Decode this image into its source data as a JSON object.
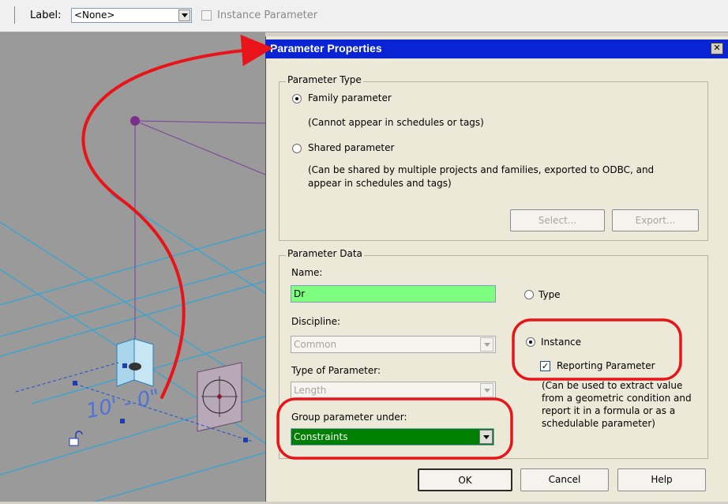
{
  "options_bar": {
    "label_caption": "Label:",
    "label_value": "<None>",
    "instance_parameter_label": "Instance Parameter"
  },
  "viewport": {
    "dimension_text": "10' - 0\""
  },
  "dialog": {
    "title": "Parameter Properties",
    "close_glyph": "✕",
    "parameter_type": {
      "group_title": "Parameter Type",
      "family_label": "Family parameter",
      "family_note": "(Cannot appear in schedules or tags)",
      "shared_label": "Shared parameter",
      "shared_note_line1": "(Can be shared by multiple projects and families, exported to ODBC, and",
      "shared_note_line2": "appear in schedules and tags)",
      "select_button": "Select...",
      "export_button": "Export..."
    },
    "parameter_data": {
      "group_title": "Parameter Data",
      "name_label": "Name:",
      "name_value": "Dr",
      "type_label": "Type",
      "discipline_label": "Discipline:",
      "discipline_value": "Common",
      "instance_label": "Instance",
      "type_of_parameter_label": "Type of Parameter:",
      "type_of_parameter_value": "Length",
      "reporting_label": "Reporting Parameter",
      "reporting_note_line1": "(Can be used to extract value",
      "reporting_note_line2": "from a geometric condition and",
      "reporting_note_line3": "report it in a formula or as a",
      "reporting_note_line4": "schedulable parameter)",
      "group_under_label": "Group parameter under:",
      "group_under_value": "Constraints"
    },
    "buttons": {
      "ok": "OK",
      "cancel": "Cancel",
      "help": "Help"
    }
  },
  "colors": {
    "annotation": "#e8141a",
    "name_field": "#7fff7f",
    "group_field": "#008000",
    "titlebar": "#0a24d4",
    "grid": "#2ba7d8"
  }
}
